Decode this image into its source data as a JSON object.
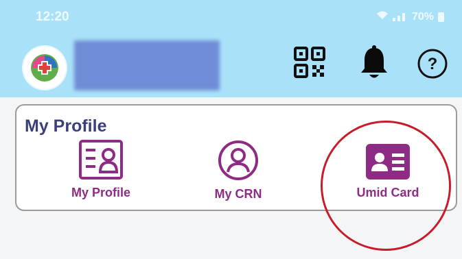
{
  "status_bar": {
    "time": "12:20",
    "battery": "70%"
  },
  "header": {
    "logo_icon": "health-logo-icon",
    "qr_icon": "qr-code-icon",
    "notification_icon": "bell-icon",
    "help_icon": "help-icon",
    "background_color": "#a9e2f8"
  },
  "profile_section": {
    "title": "My Profile",
    "items": [
      {
        "label": "My Profile",
        "icon": "profile-card-icon"
      },
      {
        "label": "My CRN",
        "icon": "user-circle-icon"
      },
      {
        "label": "Umid Card",
        "icon": "id-card-icon"
      }
    ],
    "accent_color": "#8e2b84",
    "highlight_color": "#c61c2b"
  }
}
